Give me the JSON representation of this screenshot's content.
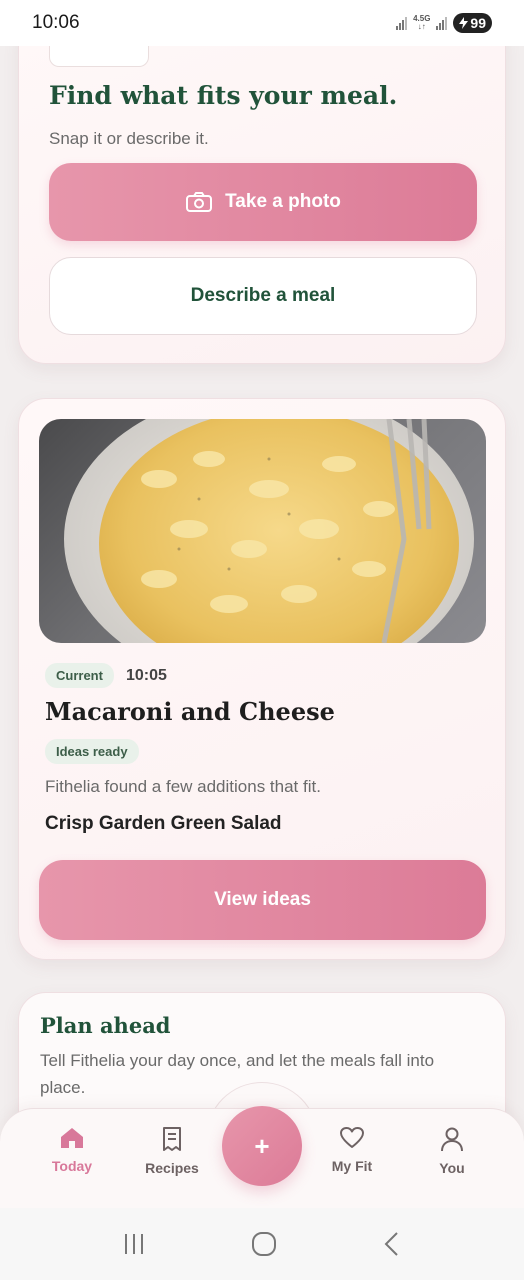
{
  "status_bar": {
    "time": "10:06",
    "network": "4.5G",
    "battery": "99"
  },
  "hero": {
    "title": "Find what fits your meal.",
    "subtitle": "Snap it or describe it.",
    "photo_button": "Take a photo",
    "describe_button": "Describe a meal"
  },
  "meal_card": {
    "status_badge": "Current",
    "time": "10:05",
    "title": "Macaroni and Cheese",
    "ideas_badge": "Ideas ready",
    "ideas_text": "Fithelia found a few additions that fit.",
    "addition": "Crisp Garden Green Salad",
    "view_button": "View ideas"
  },
  "plan": {
    "title": "Plan ahead",
    "text": "Tell Fithelia your day once, and let the meals fall into place."
  },
  "bottom_nav": {
    "items": [
      {
        "label": "Today",
        "icon": "home-icon",
        "active": true
      },
      {
        "label": "Recipes",
        "icon": "recipe-icon",
        "active": false
      },
      {
        "label": "My Fit",
        "icon": "heart-icon",
        "active": false
      },
      {
        "label": "You",
        "icon": "user-icon",
        "active": false
      }
    ],
    "fab_icon": "plus-icon",
    "fab_label": "+"
  },
  "colors": {
    "accent": "#dc7b97",
    "heading_green": "#21533a"
  }
}
